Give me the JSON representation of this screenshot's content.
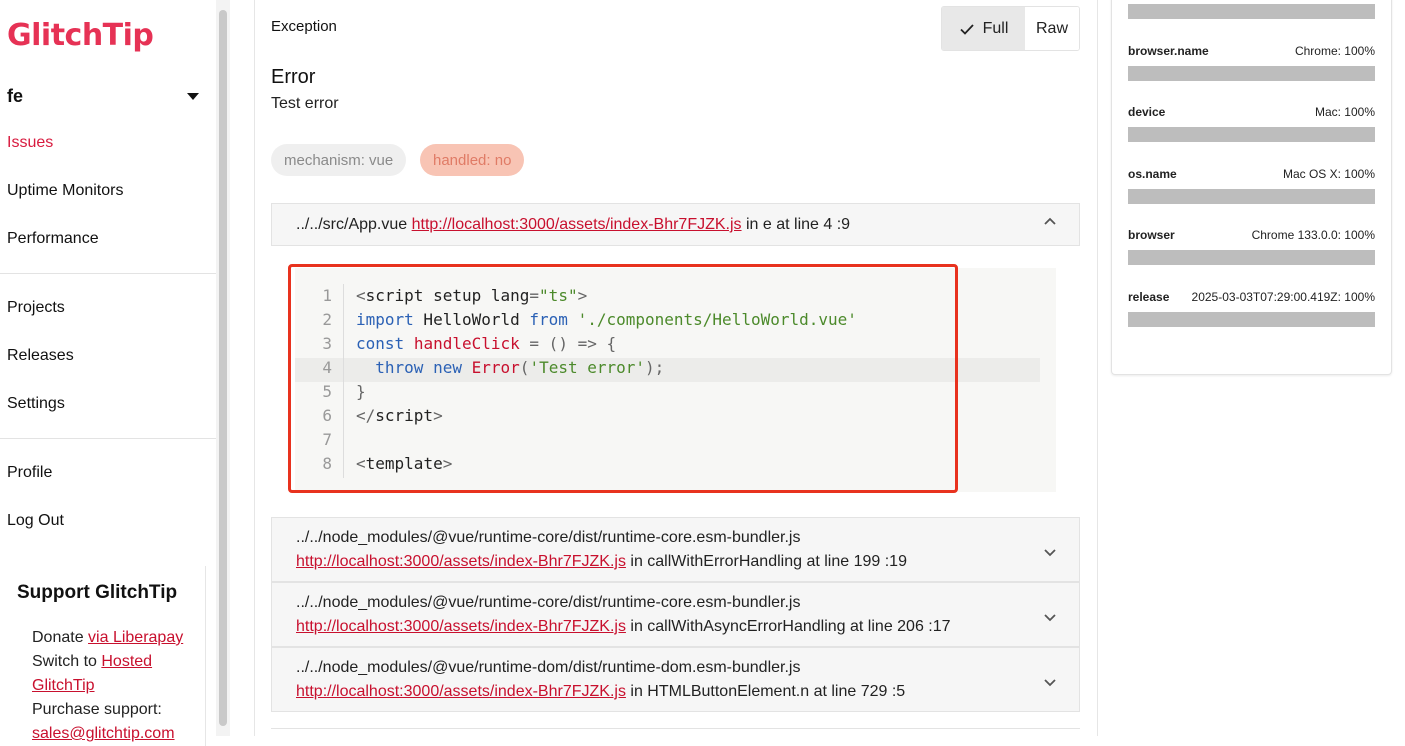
{
  "sidebar": {
    "logo": "GlitchTip",
    "org": "fe",
    "nav": [
      "Issues",
      "Uptime Monitors",
      "Performance"
    ],
    "nav2": [
      "Projects",
      "Releases",
      "Settings"
    ],
    "nav3": [
      "Profile",
      "Log Out"
    ],
    "support": {
      "title": "Support GlitchTip",
      "donate_prefix": "Donate ",
      "donate_link": "via Liberapay",
      "switch_prefix": "Switch to ",
      "hosted_link": "Hosted",
      "hosted_link2": "GlitchTip",
      "purchase": "Purchase support:",
      "email": "sales@glitchtip.com"
    }
  },
  "exception": {
    "label": "Exception",
    "toggle_full": "Full",
    "toggle_raw": "Raw",
    "error_type": "Error",
    "error_message": "Test error",
    "tags": [
      "mechanism: vue",
      "handled: no"
    ]
  },
  "frames": [
    {
      "file": "../../src/App.vue",
      "url": "http://localhost:3000/assets/index-Bhr7FJZK.js",
      "suffix": " in e at line 4 :9"
    },
    {
      "file": "../../node_modules/@vue/runtime-core/dist/runtime-core.esm-bundler.js",
      "url": "http://localhost:3000/assets/index-Bhr7FJZK.js",
      "suffix": " in callWithErrorHandling at line 199 :19"
    },
    {
      "file": "../../node_modules/@vue/runtime-core/dist/runtime-core.esm-bundler.js",
      "url": "http://localhost:3000/assets/index-Bhr7FJZK.js",
      "suffix": " in callWithAsyncErrorHandling at line 206 :17"
    },
    {
      "file": "../../node_modules/@vue/runtime-dom/dist/runtime-dom.esm-bundler.js",
      "url": "http://localhost:3000/assets/index-Bhr7FJZK.js",
      "suffix": " in HTMLButtonElement.n at line 729 :5"
    }
  ],
  "code": {
    "line_numbers": [
      "1",
      "2",
      "3",
      "4",
      "5",
      "6",
      "7",
      "8"
    ],
    "l1a": "<",
    "l1b": "script",
    "l1c": " setup ",
    "l1d": "lang",
    "l1e": "=",
    "l1f": "\"ts\"",
    "l1g": ">",
    "l2a": "import",
    "l2b": " HelloWorld ",
    "l2c": "from",
    "l2d": " ",
    "l2e": "'./components/HelloWorld.vue'",
    "l3a": "const",
    "l3b": " ",
    "l3c": "handleClick",
    "l3d": " = () => {",
    "l4a": "  ",
    "l4b": "throw",
    "l4c": " ",
    "l4d": "new",
    "l4e": " ",
    "l4f": "Error",
    "l4g": "(",
    "l4h": "'Test error'",
    "l4i": ");",
    "l5": "}",
    "l6a": "</",
    "l6b": "script",
    "l6c": ">",
    "l8a": "<",
    "l8b": "template",
    "l8c": ">"
  },
  "tags_panel": [
    {
      "key": "browser.name",
      "value": "Chrome: 100%"
    },
    {
      "key": "device",
      "value": "Mac: 100%"
    },
    {
      "key": "os.name",
      "value": "Mac OS X: 100%"
    },
    {
      "key": "browser",
      "value": "Chrome 133.0.0: 100%"
    },
    {
      "key": "release",
      "value": "2025-03-03T07:29:00.419Z: 100%"
    }
  ],
  "colors": {
    "brand": "#e63255",
    "link": "#c8102e",
    "highlight_border": "#e8321e"
  }
}
